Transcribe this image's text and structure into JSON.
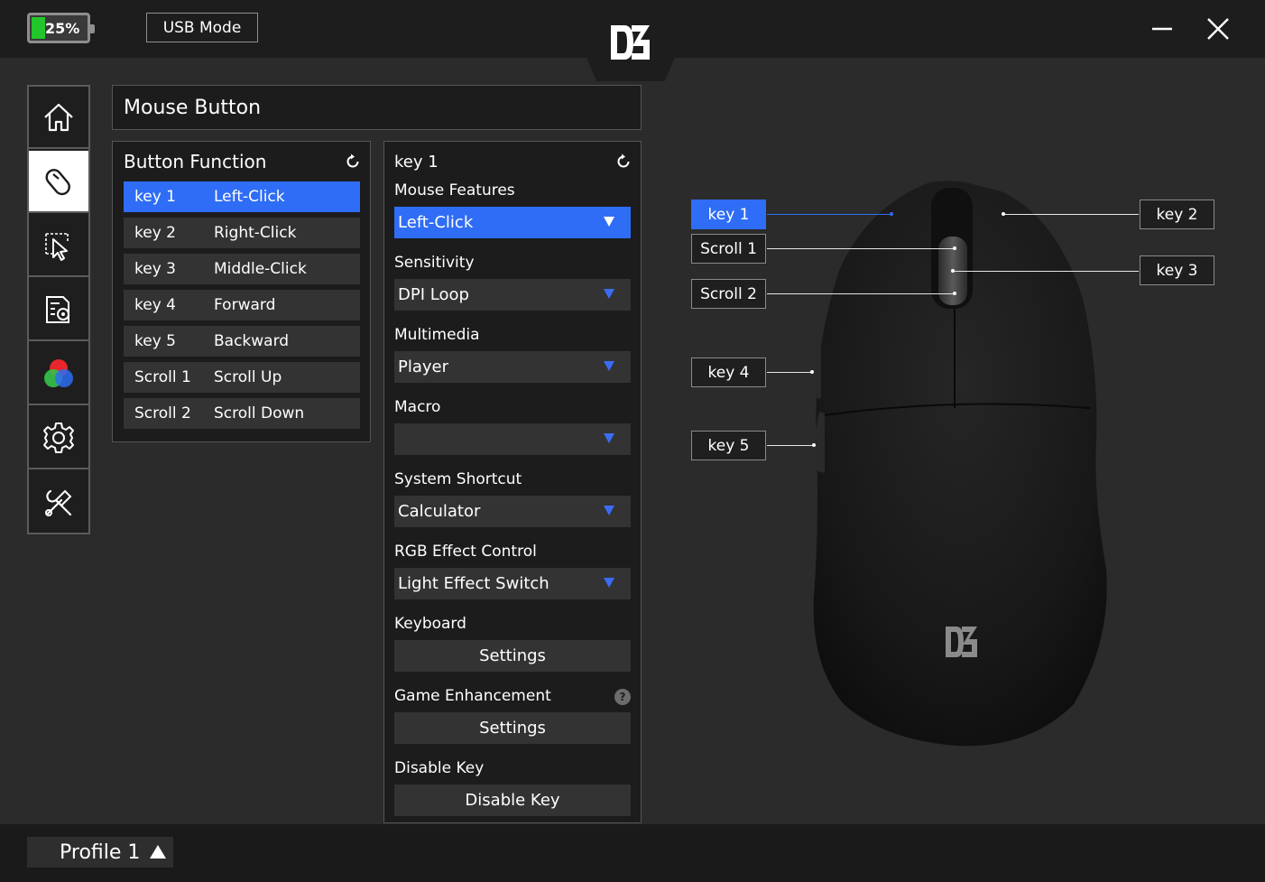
{
  "topbar": {
    "battery_text": "25%",
    "battery_level_percent": 25,
    "battery_color": "#22c52b",
    "mode_label": "USB Mode",
    "logo_icon": "brand-logo-icon",
    "minimize_icon": "minimize-icon",
    "close_icon": "close-icon"
  },
  "sidebar": {
    "items": [
      {
        "name": "home",
        "icon": "home-icon",
        "active": false
      },
      {
        "name": "mouse-button",
        "icon": "mouse-icon",
        "active": true
      },
      {
        "name": "performance",
        "icon": "cursor-select-icon",
        "active": false
      },
      {
        "name": "macro",
        "icon": "document-gear-icon",
        "active": false
      },
      {
        "name": "lighting",
        "icon": "rgb-icon",
        "active": false
      },
      {
        "name": "settings",
        "icon": "gear-icon",
        "active": false
      },
      {
        "name": "tools",
        "icon": "tools-icon",
        "active": false
      }
    ]
  },
  "header": {
    "title": "Mouse Button"
  },
  "button_function": {
    "title": "Button Function",
    "reset_icon": "reset-icon",
    "rows": [
      {
        "key": "key 1",
        "function": "Left-Click",
        "active": true
      },
      {
        "key": "key 2",
        "function": "Right-Click",
        "active": false
      },
      {
        "key": "key 3",
        "function": "Middle-Click",
        "active": false
      },
      {
        "key": "key 4",
        "function": "Forward",
        "active": false
      },
      {
        "key": "key 5",
        "function": "Backward",
        "active": false
      },
      {
        "key": "Scroll 1",
        "function": "Scroll Up",
        "active": false
      },
      {
        "key": "Scroll 2",
        "function": "Scroll Down",
        "active": false
      }
    ]
  },
  "key_settings": {
    "key_title": "key 1",
    "mouse_features": {
      "label": "Mouse Features",
      "value": "Left-Click"
    },
    "sensitivity": {
      "label": "Sensitivity",
      "value": "DPI Loop"
    },
    "multimedia": {
      "label": "Multimedia",
      "value": "Player"
    },
    "macro": {
      "label": "Macro",
      "value": ""
    },
    "system_shortcut": {
      "label": "System Shortcut",
      "value": "Calculator"
    },
    "rgb_effect": {
      "label": "RGB Effect Control",
      "value": "Light Effect Switch"
    },
    "keyboard": {
      "label": "Keyboard",
      "button": "Settings"
    },
    "game_enhancement": {
      "label": "Game Enhancement",
      "button": "Settings",
      "help": "?"
    },
    "disable_key": {
      "label": "Disable Key",
      "button": "Disable Key"
    }
  },
  "mouse_diagram": {
    "callouts": {
      "key1": "key 1",
      "key2": "key 2",
      "key3": "key 3",
      "scroll1": "Scroll 1",
      "scroll2": "Scroll 2",
      "key4": "key 4",
      "key5": "key 5"
    },
    "active_callout": "key 1"
  },
  "bottombar": {
    "profile_label": "Profile 1"
  },
  "colors": {
    "accent": "#2f6df6",
    "panel_bg": "#1c1c1c",
    "app_bg": "#2b2b2b",
    "row_bg": "#333333"
  }
}
